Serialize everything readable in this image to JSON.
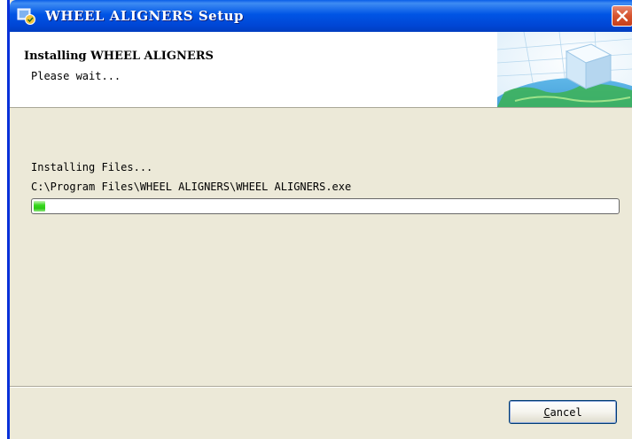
{
  "window": {
    "title": "WHEEL ALIGNERS Setup",
    "title_icon": "installer-icon",
    "close_icon": "close-icon",
    "colors": {
      "titlebar": "#0055e5",
      "body": "#ece9d8",
      "close": "#d6532e"
    }
  },
  "header": {
    "title": "Installing WHEEL ALIGNERS",
    "subtitle": "Please wait...",
    "logo": "globe-cube-logo"
  },
  "main": {
    "status": "Installing Files...",
    "current_file": "C:\\Program Files\\WHEEL ALIGNERS\\WHEEL ALIGNERS.exe",
    "progress": 0.02,
    "progress_color": "#37d81e"
  },
  "footer": {
    "cancel_first_letter": "C",
    "cancel_rest": "ancel"
  }
}
